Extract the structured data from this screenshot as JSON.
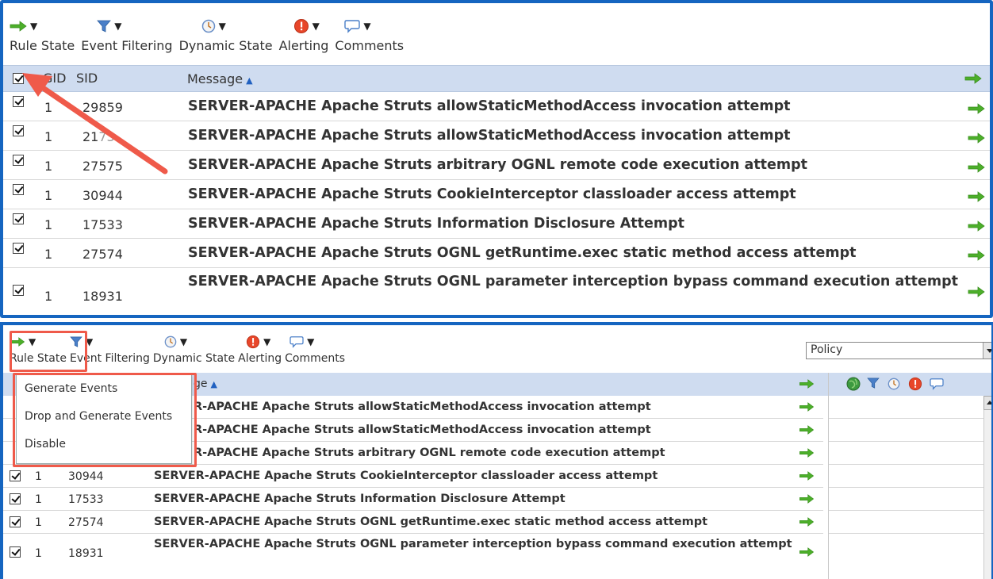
{
  "toolbar": {
    "rule_state": "Rule State",
    "event_filtering": "Event Filtering",
    "dynamic_state": "Dynamic State",
    "alerting": "Alerting",
    "comments": "Comments"
  },
  "columns": {
    "gid": "GID",
    "sid": "SID",
    "message": "Message"
  },
  "header_partial": "ge",
  "rules": [
    {
      "gid": "1",
      "sid": "29859",
      "message": "SERVER-APACHE Apache Struts allowStaticMethodAccess invocation attempt"
    },
    {
      "gid": "1",
      "sid": "21073",
      "message": "SERVER-APACHE Apache Struts allowStaticMethodAccess invocation attempt"
    },
    {
      "gid": "1",
      "sid": "27575",
      "message": "SERVER-APACHE Apache Struts arbitrary OGNL remote code execution attempt"
    },
    {
      "gid": "1",
      "sid": "30944",
      "message": "SERVER-APACHE Apache Struts CookieInterceptor classloader access attempt"
    },
    {
      "gid": "1",
      "sid": "17533",
      "message": "SERVER-APACHE Apache Struts Information Disclosure Attempt"
    },
    {
      "gid": "1",
      "sid": "27574",
      "message": "SERVER-APACHE Apache Struts OGNL getRuntime.exec static method access attempt"
    },
    {
      "gid": "1",
      "sid": "18931",
      "message": "SERVER-APACHE Apache Struts OGNL parameter interception bypass command execution attempt"
    }
  ],
  "panel1_sids": [
    "29859",
    "21",
    "27575",
    "30944",
    "17533",
    "27574",
    "18931"
  ],
  "panel1_sid_tail": "73",
  "panel2_partial_messages": [
    "R-APACHE Apache Struts allowStaticMethodAccess invocation attempt",
    "R-APACHE Apache Struts allowStaticMethodAccess invocation attempt",
    "R-APACHE Apache Struts arbitrary OGNL remote code execution attempt"
  ],
  "rule_state_menu": [
    "Generate Events",
    "Drop and Generate Events",
    "Disable"
  ],
  "policy_select": {
    "value": "Policy"
  },
  "colors": {
    "accent_border": "#1565c0",
    "header_bg": "#cfdcf0",
    "highlight_box": "#ef5a4a",
    "arrow_green": "#4caf2a"
  },
  "icons": [
    "green-arrow-icon",
    "filter-funnel-icon",
    "clock-icon",
    "alert-icon",
    "comment-bubble-icon",
    "globe-icon"
  ]
}
